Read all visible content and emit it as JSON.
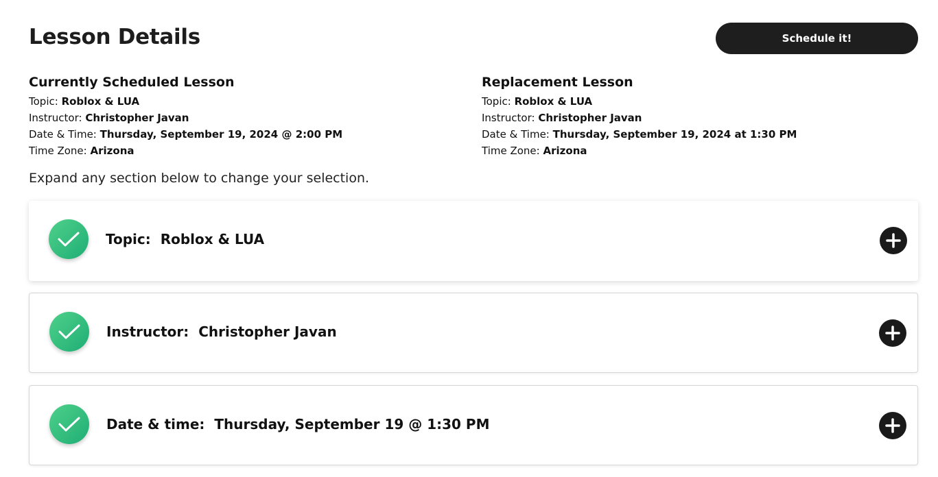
{
  "header": {
    "title": "Lesson Details",
    "schedule_label": "Schedule it!"
  },
  "current": {
    "heading": "Currently Scheduled Lesson",
    "topic_label": "Topic:",
    "topic": "Roblox & LUA",
    "instructor_label": "Instructor:",
    "instructor": "Christopher Javan",
    "datetime_label": "Date & Time:",
    "datetime": "Thursday, September 19, 2024 @ 2:00 PM",
    "timezone_label": "Time Zone:",
    "timezone": "Arizona"
  },
  "replacement": {
    "heading": "Replacement Lesson",
    "topic_label": "Topic:",
    "topic": "Roblox & LUA",
    "instructor_label": "Instructor:",
    "instructor": "Christopher Javan",
    "datetime_label": "Date & Time:",
    "datetime": "Thursday, September 19, 2024 at 1:30 PM",
    "timezone_label": "Time Zone:",
    "timezone": "Arizona"
  },
  "instruction": "Expand any section below to change your selection.",
  "sections": [
    {
      "label": "Topic:",
      "value": "Roblox & LUA",
      "icon": "check-icon",
      "action_icon": "plus-icon"
    },
    {
      "label": "Instructor:",
      "value": "Christopher Javan",
      "icon": "check-icon",
      "action_icon": "plus-icon"
    },
    {
      "label": "Date & time:",
      "value": "Thursday, September 19 @ 1:30 PM",
      "icon": "check-icon",
      "action_icon": "plus-icon"
    }
  ],
  "colors": {
    "accent_green": "#2fbf7d",
    "button_dark": "#1e1e1e"
  }
}
